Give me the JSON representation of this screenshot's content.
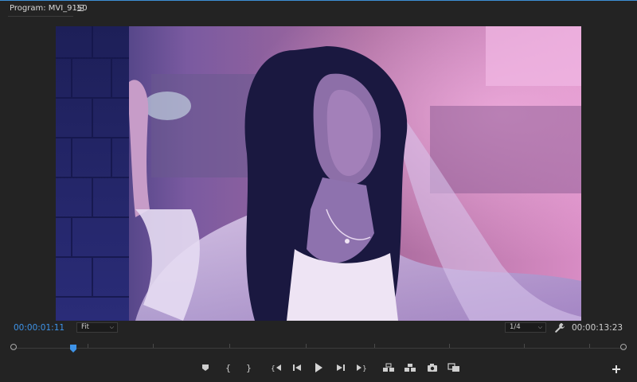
{
  "panel": {
    "title": "Program: MVI_9150",
    "menu_icon": "hamburger-menu-icon"
  },
  "viewer": {
    "description_icon": "video-frame"
  },
  "status": {
    "current_timecode": "00:00:01:11",
    "zoom_level": "Fit",
    "playback_resolution": "1/4",
    "duration_timecode": "00:00:13:23"
  },
  "timeline": {
    "playhead_position_fraction": 0.1
  },
  "transport": {
    "buttons": [
      {
        "name": "add-marker-icon"
      },
      {
        "name": "mark-in-icon"
      },
      {
        "name": "mark-out-icon"
      },
      {
        "name": "go-to-in-icon"
      },
      {
        "name": "step-back-icon"
      },
      {
        "name": "play-icon"
      },
      {
        "name": "step-forward-icon"
      },
      {
        "name": "go-to-out-icon"
      },
      {
        "name": "lift-icon"
      },
      {
        "name": "extract-icon"
      },
      {
        "name": "export-frame-icon"
      },
      {
        "name": "comparison-view-icon"
      }
    ],
    "add_button_icon": "plus-icon"
  },
  "colors": {
    "accent": "#3e93e8",
    "background": "#232323"
  }
}
